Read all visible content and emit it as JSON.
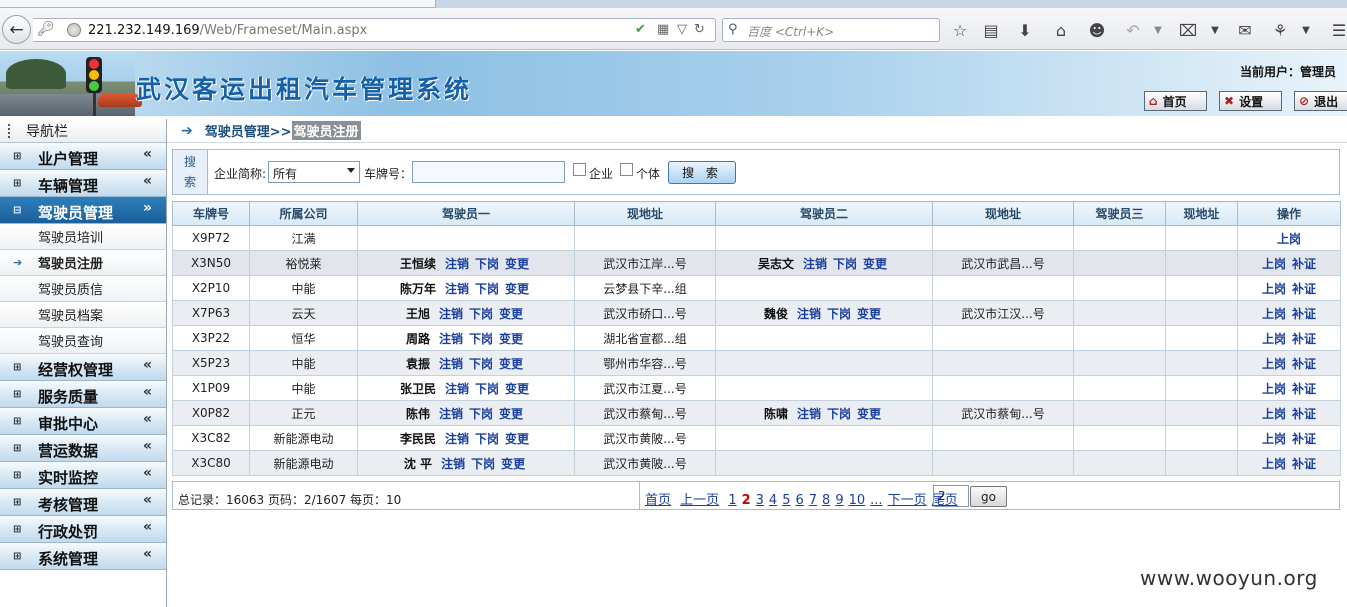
{
  "browser": {
    "url_host": "221.232.149.169",
    "url_path": "/Web/Frameset/Main.aspx",
    "search_placeholder": "百度 <Ctrl+K>"
  },
  "header": {
    "title": "武汉客运出租汽车管理系统",
    "user_label": "当前用户：管理员",
    "buttons": {
      "home": "首页",
      "settings": "设置",
      "logout": "退出"
    }
  },
  "sidebar": {
    "title": "导航栏",
    "menus": [
      {
        "label": "业户管理",
        "open": false
      },
      {
        "label": "车辆管理",
        "open": false
      },
      {
        "label": "驾驶员管理",
        "open": true,
        "items": [
          "驾驶员培训",
          "驾驶员注册",
          "驾驶员质信",
          "驾驶员档案",
          "驾驶员查询"
        ]
      },
      {
        "label": "经营权管理",
        "open": false
      },
      {
        "label": "服务质量",
        "open": false
      },
      {
        "label": "审批中心",
        "open": false
      },
      {
        "label": "营运数据",
        "open": false
      },
      {
        "label": "实时监控",
        "open": false
      },
      {
        "label": "考核管理",
        "open": false
      },
      {
        "label": "行政处罚",
        "open": false
      },
      {
        "label": "系统管理",
        "open": false
      }
    ]
  },
  "breadcrumb": {
    "parent": "驾驶员管理>>",
    "current": "驾驶员注册"
  },
  "search": {
    "tag": "搜索",
    "company_label": "企业简称:",
    "company_value": "所有",
    "plate_label": "车牌号：",
    "plate_value": "",
    "check_enterprise": "企业",
    "check_individual": "个体",
    "button": "搜 索"
  },
  "table": {
    "headers": [
      "车牌号",
      "所属公司",
      "驾驶员一",
      "现地址",
      "驾驶员二",
      "现地址",
      "驾驶员三",
      "现地址",
      "操作"
    ],
    "actions": {
      "cancel": "注销",
      "off": "下岗",
      "change": "变更",
      "on": "上岗",
      "reissue": "补证"
    },
    "rows": [
      {
        "plate": "X9P72",
        "company": "江满",
        "d1": "",
        "a1": "",
        "d2": "",
        "a2": "",
        "ops": [
          "上岗"
        ]
      },
      {
        "plate": "X3N50",
        "company": "裕悦莱",
        "d1": "王恒续",
        "a1": "武汉市江岸...号",
        "d2": "吴志文",
        "a2": "武汉市武昌...号",
        "ops": [
          "上岗",
          "补证"
        ]
      },
      {
        "plate": "X2P10",
        "company": "中能",
        "d1": "陈万年",
        "a1": "云梦县下辛...组",
        "d2": "",
        "a2": "",
        "ops": [
          "上岗",
          "补证"
        ]
      },
      {
        "plate": "X7P63",
        "company": "云天",
        "d1": "王旭",
        "a1": "武汉市硚口...号",
        "d2": "魏俊",
        "a2": "武汉市江汉...号",
        "ops": [
          "上岗",
          "补证"
        ]
      },
      {
        "plate": "X3P22",
        "company": "恒华",
        "d1": "周路",
        "a1": "湖北省宣都...组",
        "d2": "",
        "a2": "",
        "ops": [
          "上岗",
          "补证"
        ]
      },
      {
        "plate": "X5P23",
        "company": "中能",
        "d1": "袁振",
        "a1": "鄂州市华容...号",
        "d2": "",
        "a2": "",
        "ops": [
          "上岗",
          "补证"
        ]
      },
      {
        "plate": "X1P09",
        "company": "中能",
        "d1": "张卫民",
        "a1": "武汉市江夏...号",
        "d2": "",
        "a2": "",
        "ops": [
          "上岗",
          "补证"
        ]
      },
      {
        "plate": "X0P82",
        "company": "正元",
        "d1": "陈伟",
        "a1": "武汉市蔡甸...号",
        "d2": "陈啸",
        "a2": "武汉市蔡甸...号",
        "ops": [
          "上岗",
          "补证"
        ]
      },
      {
        "plate": "X3C82",
        "company": "新能源电动",
        "d1": "李民民",
        "a1": "武汉市黄陂...号",
        "d2": "",
        "a2": "",
        "ops": [
          "上岗",
          "补证"
        ]
      },
      {
        "plate": "X3C80",
        "company": "新能源电动",
        "d1": "沈 平",
        "a1": "武汉市黄陂...号",
        "d2": "",
        "a2": "",
        "ops": [
          "上岗",
          "补证"
        ]
      }
    ]
  },
  "pager": {
    "summary": "总记录：16063 页码：2/1607 每页：10",
    "first": "首页",
    "prev": "上一页",
    "pages": [
      "1",
      "2",
      "3",
      "4",
      "5",
      "6",
      "7",
      "8",
      "9",
      "10",
      "..."
    ],
    "current": "2",
    "next": "下一页",
    "last": "尾页",
    "input_value": "2",
    "go": "go"
  },
  "watermark": "www.wooyun.org"
}
